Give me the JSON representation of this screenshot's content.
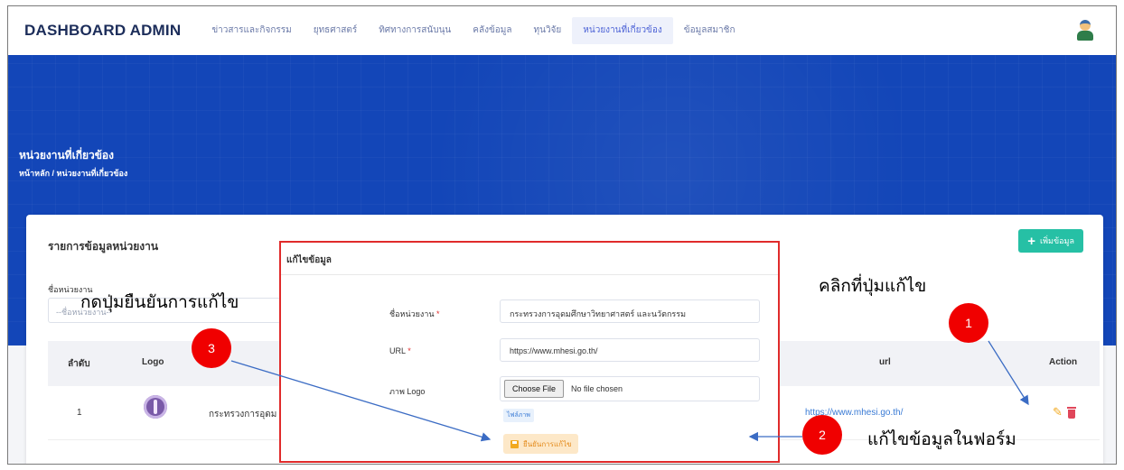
{
  "header": {
    "brand": "DASHBOARD ADMIN",
    "nav": [
      "ข่าวสารและกิจกรรม",
      "ยุทธศาสตร์",
      "ทิศทางการสนับนุน",
      "คลังข้อมูล",
      "ทุนวิจัย",
      "หน่วยงานที่เกี่ยวข้อง",
      "ข้อมูลสมาชิก"
    ],
    "active_nav": "หน่วยงานที่เกี่ยวข้อง"
  },
  "hero": {
    "title": "หน่วยงานที่เกี่ยวข้อง",
    "breadcrumb": "หน้าหลัก / หน่วยงานที่เกี่ยวข้อง"
  },
  "card": {
    "title": "รายการข้อมูลหน่วยงาน",
    "add_button": "เพิ่มข้อมูล",
    "filter_label": "ชื่อหน่วยงาน",
    "filter_placeholder": "--ชื่อหน่วยงาน--"
  },
  "table": {
    "headers": [
      "ลำดับ",
      "Logo",
      "url",
      "Action"
    ],
    "rows": [
      {
        "index": "1",
        "name": "กระทรวงการอุดม",
        "url": "https://www.mhesi.go.th/"
      }
    ]
  },
  "modal": {
    "title": "แก้ไขข้อมูล",
    "fields": {
      "name_label": "ชื่อหน่วยงาน",
      "name_value": "กระทรวงการอุดมศึกษาวิทยาศาสตร์ และนวัตกรรม",
      "url_label": "URL",
      "url_value": "https://www.mhesi.go.th/",
      "logo_label": "ภาพ Logo",
      "file_button": "Choose File",
      "file_status": "No file chosen",
      "image_chip": "ไฟล์ภาพ",
      "required_mark": "*"
    },
    "confirm_button": "ยืนยันการแก้ไข"
  },
  "annotations": {
    "step1_number": "1",
    "step2_number": "2",
    "step3_number": "3",
    "step1_text": "คลิกที่ปุ่มแก้ไข",
    "step2_text": "แก้ไขข้อมูลในฟอร์ม",
    "step3_text": "กดปุ่มยืนยันการแก้ไข"
  },
  "colors": {
    "hero_blue": "#1346b8",
    "add_green": "#26c0a5",
    "annotation_red": "#f00000",
    "arrow_blue": "#3b6cc4",
    "edit_orange": "#f2a91f",
    "delete_red": "#e0465a"
  }
}
